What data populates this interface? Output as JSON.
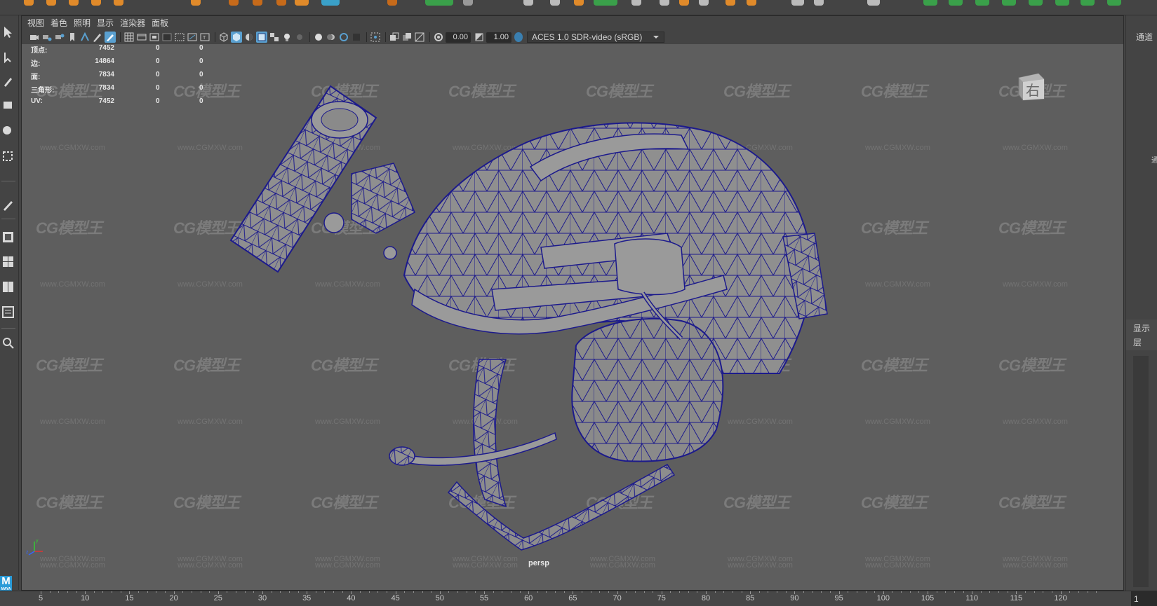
{
  "panel_menu": [
    "视图",
    "着色",
    "照明",
    "显示",
    "渲染器",
    "面板"
  ],
  "toolbar": {
    "exposure": "0.00",
    "gamma": "1.00",
    "colorspace": "ACES 1.0 SDR-video (sRGB)",
    "colorspace_dropdown_icon": "chevron-down-icon"
  },
  "hud_stats": [
    {
      "label": "顶点:",
      "value": "7452",
      "sel": "0",
      "comp": "0"
    },
    {
      "label": "边:",
      "value": "14864",
      "sel": "0",
      "comp": "0"
    },
    {
      "label": "面:",
      "value": "7834",
      "sel": "0",
      "comp": "0"
    },
    {
      "label": "三角形:",
      "value": "7834",
      "sel": "0",
      "comp": "0"
    },
    {
      "label": "UV:",
      "value": "7452",
      "sel": "0",
      "comp": "0"
    }
  ],
  "viewport": {
    "camera": "persp",
    "view_cube_label": "右",
    "background_color": "#5e5e5e",
    "wireframe_color": "#1c1a8c"
  },
  "watermark": {
    "logo": "CG模型王",
    "url": "www.CGMXW.com"
  },
  "right_panel": {
    "channel_tab": "通道",
    "channel_tab_cut": "通",
    "display_tab": "显示",
    "layer_tab": "层"
  },
  "time_slider": {
    "ticks": [
      "5",
      "10",
      "15",
      "20",
      "25",
      "30",
      "35",
      "40",
      "45",
      "50",
      "55",
      "60",
      "65",
      "70",
      "75",
      "80",
      "85",
      "90",
      "95",
      "100",
      "105",
      "110",
      "115",
      "120"
    ],
    "current_frame": "1"
  },
  "app": {
    "logo_letter": "M",
    "logo_sub": "MAYA"
  },
  "colors": {
    "ui_bg": "#444444",
    "accent_blue": "#2a9bd8"
  }
}
